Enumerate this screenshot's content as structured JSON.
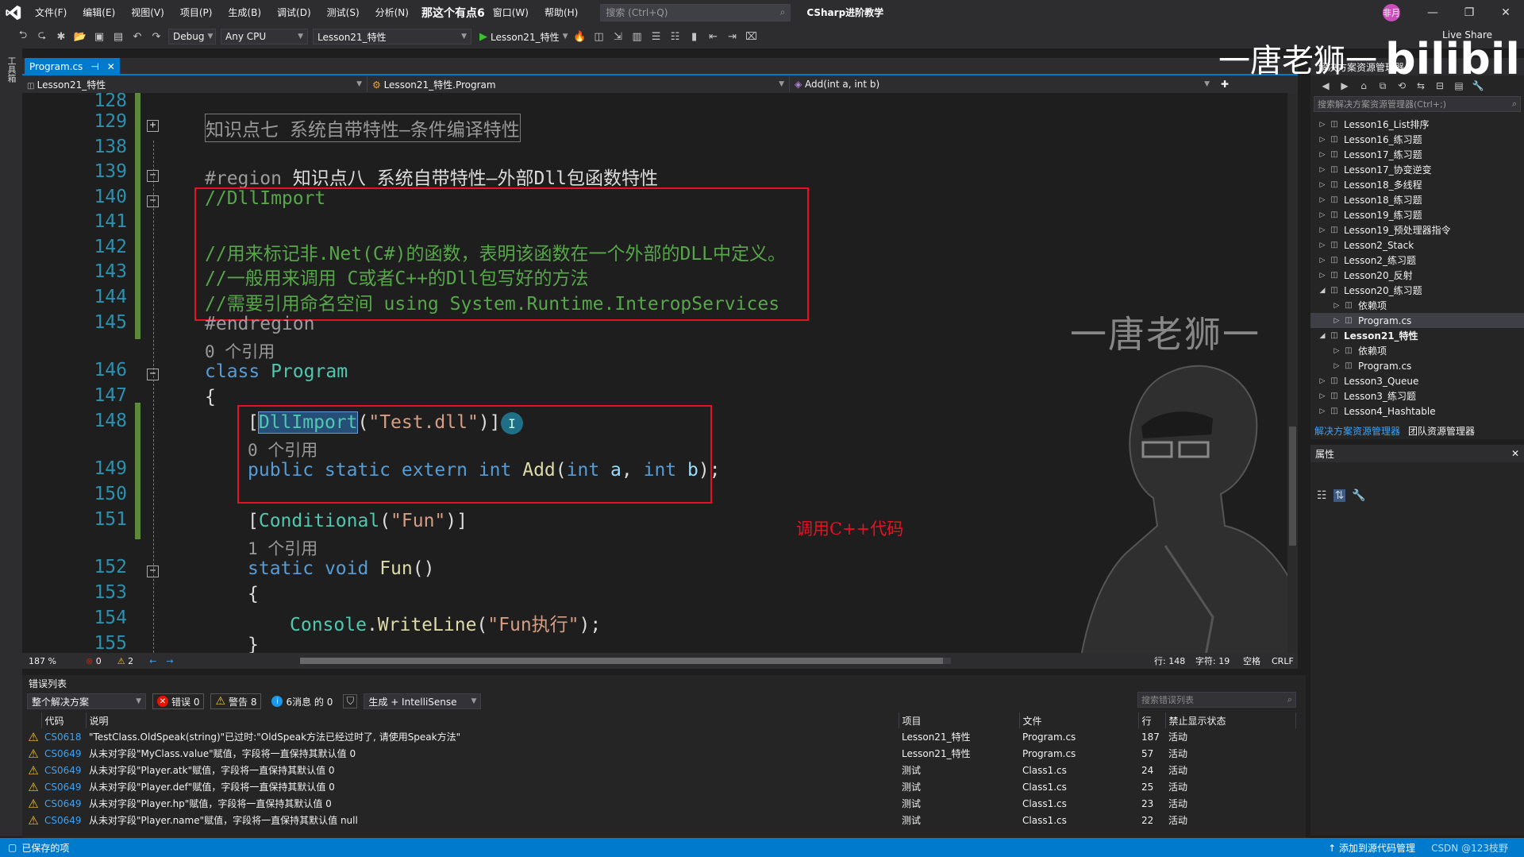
{
  "menubar": {
    "items": [
      "文件(F)",
      "编辑(E)",
      "视图(V)",
      "项目(P)",
      "生成(B)",
      "调试(D)",
      "测试(S)",
      "分析(N)"
    ],
    "overlay_text": "那这个有点6",
    "items2": [
      "窗口(W)",
      "帮助(H)"
    ],
    "search_placeholder": "搜索 (Ctrl+Q)",
    "solution_name": "CSharp进阶教学",
    "user_initials": "非月"
  },
  "toolbar": {
    "config": "Debug",
    "platform": "Any CPU",
    "startup_project": "Lesson21_特性",
    "run_label": "Lesson21_特性",
    "live_share": "Live Share"
  },
  "left_strip": {
    "label": "工具箱"
  },
  "doc_tab": {
    "label": "Program.cs"
  },
  "navbar": {
    "project": "Lesson21_特性",
    "class": "Lesson21_特性.Program",
    "member": "Add(int a, int b)"
  },
  "editor": {
    "line_numbers": [
      "128",
      "129",
      "138",
      "139",
      "140",
      "141",
      "142",
      "143",
      "144",
      "145",
      "146",
      "147",
      "148",
      "149",
      "150",
      "151",
      "152",
      "153",
      "154",
      "155"
    ],
    "collapsed_region": "知识点七 系统自带特性—条件编译特性",
    "region_kw": "#region",
    "region_title": "知识点八 系统自带特性—外部Dll包函数特性",
    "comment1": "//DllImport",
    "comment2": "//用来标记非.Net(C#)的函数，表明该函数在一个外部的DLL中定义。",
    "comment3": "//一般用来调用 C或者C++的Dll包写好的方法",
    "comment4": "//需要引用命名空间 using System.Runtime.InteropServices",
    "endregion": "#endregion",
    "refs0": "0 个引用",
    "refs1": "1 个引用",
    "class_kw": "class",
    "class_name": "Program",
    "brace_open": "{",
    "brace_close": "}",
    "attr_open": "[",
    "attr_name": "DllImport",
    "attr_arg_open": "(",
    "attr_string": "\"Test.dll\"",
    "attr_close": ")]",
    "decl_mods": "public static extern",
    "int_kw": "int",
    "method_name": "Add",
    "param_a": "a",
    "param_b": "b",
    "cond_attr": "Conditional",
    "cond_string": "\"Fun\"",
    "static_kw": "static",
    "void_kw": "void",
    "fun_name": "Fun",
    "console_type": "Console",
    "writeline": "WriteLine",
    "fun_string": "\"Fun执行\"",
    "annotation": "调用C++代码",
    "watermark": "一唐老狮一"
  },
  "editor_status": {
    "zoom": "187 %",
    "errors": "0",
    "warnings": "2",
    "line": "行: 148",
    "char": "字符: 19",
    "space": "空格",
    "eol": "CRLF"
  },
  "solution_explorer": {
    "title": "解决方案资源管理器",
    "search_placeholder": "搜索解决方案资源管理器(Ctrl+;)",
    "items": [
      {
        "label": "Lesson16_List排序",
        "level": 0,
        "exp": "▷",
        "bold": false,
        "sel": false
      },
      {
        "label": "Lesson16_练习题",
        "level": 0,
        "exp": "▷",
        "bold": false,
        "sel": false
      },
      {
        "label": "Lesson17_练习题",
        "level": 0,
        "exp": "▷",
        "bold": false,
        "sel": false
      },
      {
        "label": "Lesson17_协变逆变",
        "level": 0,
        "exp": "▷",
        "bold": false,
        "sel": false
      },
      {
        "label": "Lesson18_多线程",
        "level": 0,
        "exp": "▷",
        "bold": false,
        "sel": false
      },
      {
        "label": "Lesson18_练习题",
        "level": 0,
        "exp": "▷",
        "bold": false,
        "sel": false
      },
      {
        "label": "Lesson19_练习题",
        "level": 0,
        "exp": "▷",
        "bold": false,
        "sel": false
      },
      {
        "label": "Lesson19_预处理器指令",
        "level": 0,
        "exp": "▷",
        "bold": false,
        "sel": false
      },
      {
        "label": "Lesson2_Stack",
        "level": 0,
        "exp": "▷",
        "bold": false,
        "sel": false
      },
      {
        "label": "Lesson2_练习题",
        "level": 0,
        "exp": "▷",
        "bold": false,
        "sel": false
      },
      {
        "label": "Lesson20_反射",
        "level": 0,
        "exp": "▷",
        "bold": false,
        "sel": false
      },
      {
        "label": "Lesson20_练习题",
        "level": 0,
        "exp": "◢",
        "bold": false,
        "sel": false
      },
      {
        "label": "依赖项",
        "level": 1,
        "exp": "▷",
        "bold": false,
        "sel": false
      },
      {
        "label": "Program.cs",
        "level": 1,
        "exp": "▷",
        "bold": false,
        "sel": true
      },
      {
        "label": "Lesson21_特性",
        "level": 0,
        "exp": "◢",
        "bold": true,
        "sel": false
      },
      {
        "label": "依赖项",
        "level": 1,
        "exp": "▷",
        "bold": false,
        "sel": false
      },
      {
        "label": "Program.cs",
        "level": 1,
        "exp": "▷",
        "bold": false,
        "sel": false
      },
      {
        "label": "Lesson3_Queue",
        "level": 0,
        "exp": "▷",
        "bold": false,
        "sel": false
      },
      {
        "label": "Lesson3_练习题",
        "level": 0,
        "exp": "▷",
        "bold": false,
        "sel": false
      },
      {
        "label": "Lesson4_Hashtable",
        "level": 0,
        "exp": "▷",
        "bold": false,
        "sel": false
      }
    ],
    "tab_active": "解决方案资源管理器",
    "tab_other": "团队资源管理器"
  },
  "properties": {
    "title": "属性"
  },
  "error_list": {
    "title": "错误列表",
    "scope": "整个解决方案",
    "errors_label": "错误 0",
    "warnings_label": "警告 8",
    "messages_label": "6消息 的 0",
    "build_filter": "生成 + IntelliSense",
    "search_placeholder": "搜索错误列表",
    "columns": [
      "代码",
      "说明",
      "项目",
      "文件",
      "行",
      "禁止显示状态"
    ],
    "rows": [
      {
        "code": "CS0618",
        "desc": "\"TestClass.OldSpeak(string)\"已过时:\"OldSpeak方法已经过时了, 请使用Speak方法\"",
        "project": "Lesson21_特性",
        "file": "Program.cs",
        "line": "187",
        "state": "活动"
      },
      {
        "code": "CS0649",
        "desc": "从未对字段\"MyClass.value\"赋值，字段将一直保持其默认值 0",
        "project": "Lesson21_特性",
        "file": "Program.cs",
        "line": "57",
        "state": "活动"
      },
      {
        "code": "CS0649",
        "desc": "从未对字段\"Player.atk\"赋值，字段将一直保持其默认值 0",
        "project": "测试",
        "file": "Class1.cs",
        "line": "24",
        "state": "活动"
      },
      {
        "code": "CS0649",
        "desc": "从未对字段\"Player.def\"赋值，字段将一直保持其默认值 0",
        "project": "测试",
        "file": "Class1.cs",
        "line": "25",
        "state": "活动"
      },
      {
        "code": "CS0649",
        "desc": "从未对字段\"Player.hp\"赋值，字段将一直保持其默认值 0",
        "project": "测试",
        "file": "Class1.cs",
        "line": "23",
        "state": "活动"
      },
      {
        "code": "CS0649",
        "desc": "从未对字段\"Player.name\"赋值，字段将一直保持其默认值 null",
        "project": "测试",
        "file": "Class1.cs",
        "line": "22",
        "state": "活动"
      }
    ]
  },
  "statusbar": {
    "left": "已保存的项",
    "right": "添加到源代码管理",
    "credit": "CSDN @123枝野"
  },
  "overlay_logo": {
    "text": "一唐老狮一",
    "brand": "bilibili"
  }
}
